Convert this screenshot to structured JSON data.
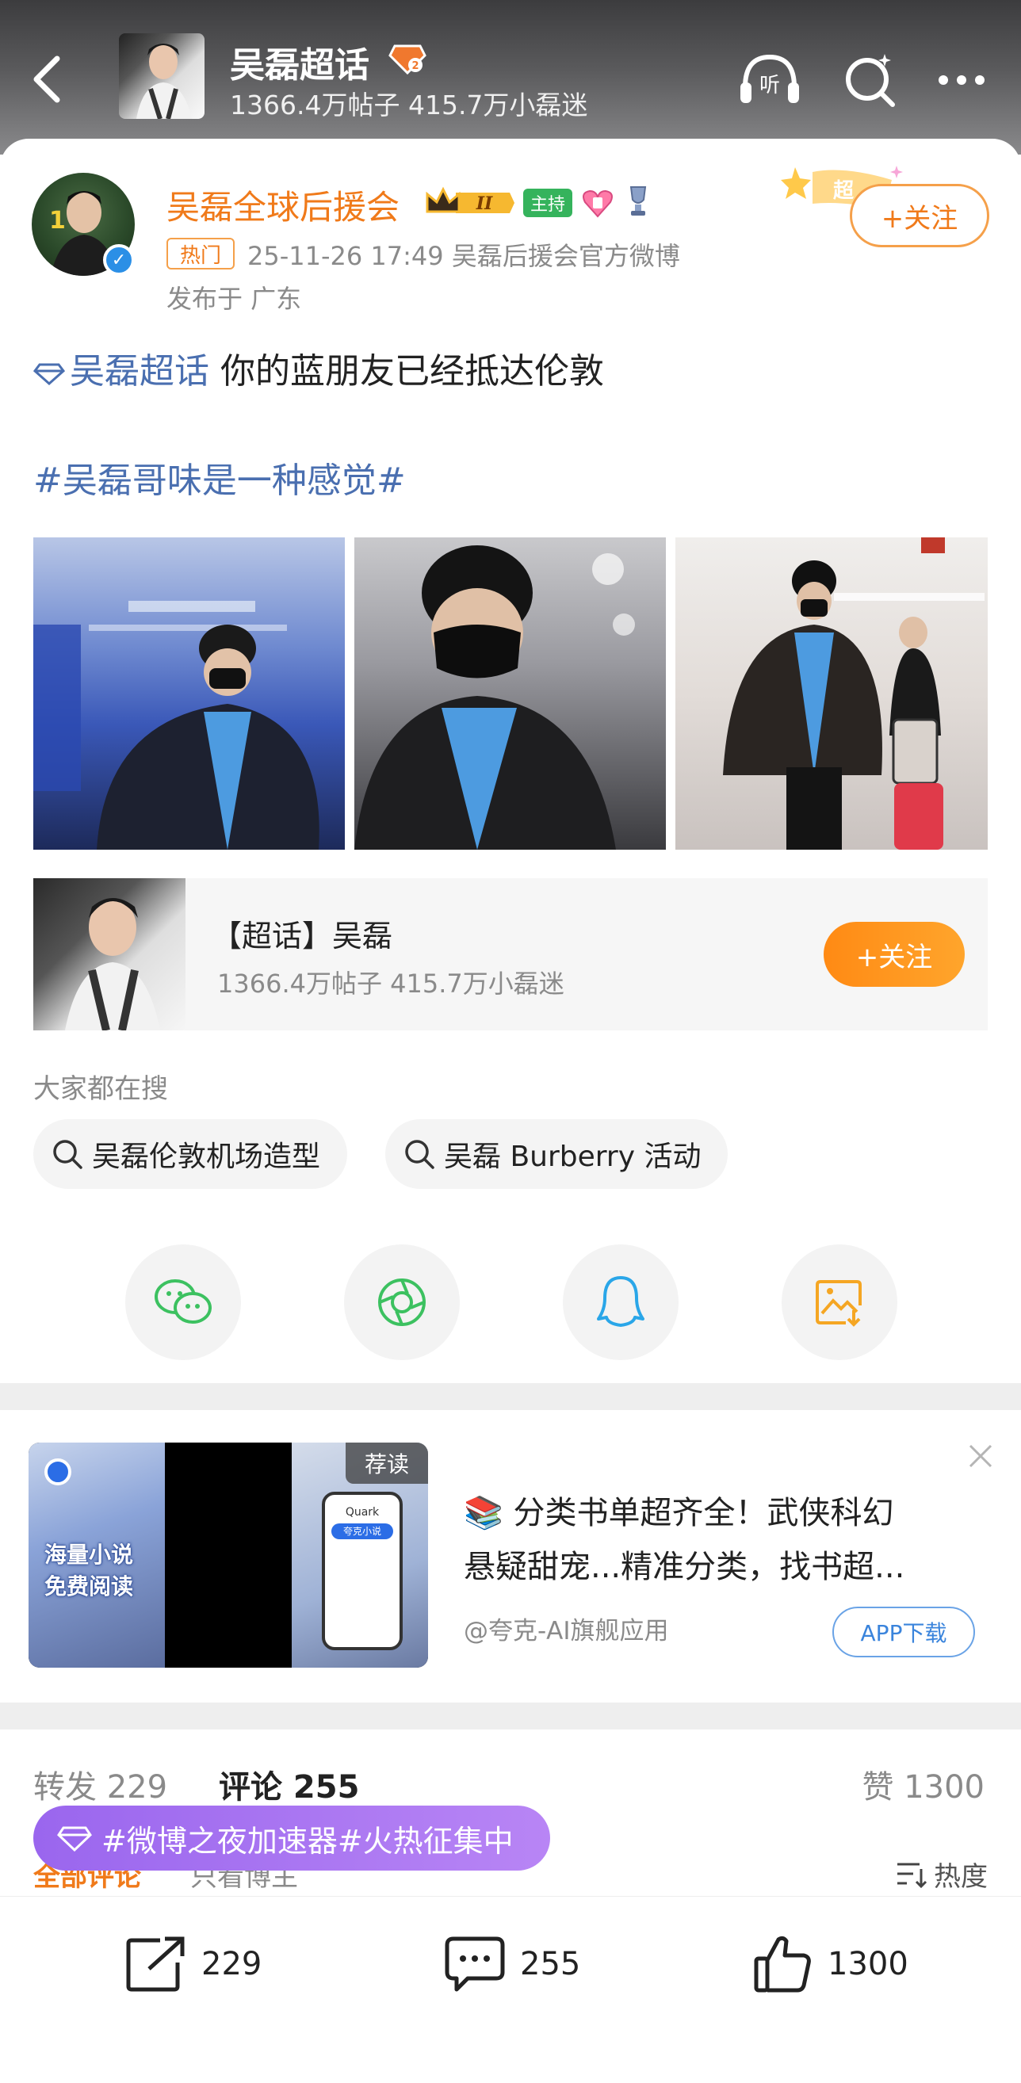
{
  "header": {
    "title": "吴磊超话",
    "subtitle": "1366.4万帖子 415.7万小磊迷",
    "listen_label": "听"
  },
  "post": {
    "author": "吴磊全球后援会",
    "host_badge": "主持",
    "crown_level": "II",
    "follow_label": "+关注",
    "follow_deco": "超",
    "hot_tag": "热门",
    "meta": "25-11-26 17:49  吴磊后援会官方微博",
    "location": "发布于 广东",
    "topic_link": "吴磊超话",
    "text": " 你的蓝朋友已经抵达伦敦",
    "hashtag": "#吴磊哥味是一种感觉#"
  },
  "supertopic": {
    "title": "【超话】吴磊",
    "subtitle": "1366.4万帖子 415.7万小磊迷",
    "follow_label": "+关注"
  },
  "search": {
    "label": "大家都在搜",
    "chips": [
      "吴磊伦敦机场造型",
      "吴磊 Burberry 活动"
    ]
  },
  "share_icons": [
    "wechat-icon",
    "moments-icon",
    "qq-icon",
    "save-image-icon"
  ],
  "ad": {
    "image_text_1": "海量小说",
    "image_text_2": "免费阅读",
    "badge": "荐读",
    "phone_brand": "Quark",
    "phone_bar": "夸克小说",
    "line1": "📚 分类书单超齐全！武侠科幻",
    "line2": "悬疑甜宠...精准分类，找书超...",
    "source": "@夸克-AI旗舰应用",
    "button": "APP下载"
  },
  "stats": {
    "forward": "转发 229",
    "comment": "评论 255",
    "like": "赞 1300"
  },
  "comment_tabs": {
    "all": "全部评论",
    "owner": "只看博主",
    "sort": "热度"
  },
  "event_banner": "#微博之夜加速器#火热征集中",
  "bottom_bar": {
    "forward_count": "229",
    "comment_count": "255",
    "like_count": "1300"
  },
  "colors": {
    "accent_orange": "#f07a1a",
    "topic_blue": "#4a6fb0",
    "event_purple": "#a873f0",
    "host_green": "#35b35c"
  }
}
